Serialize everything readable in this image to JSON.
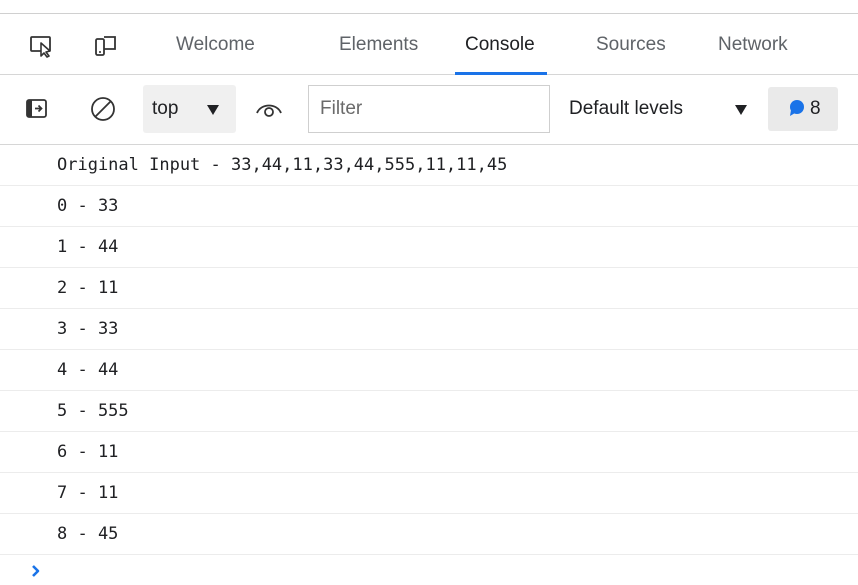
{
  "tabbar": {
    "icons": [
      "inspect-element-icon",
      "device-toolbar-icon"
    ],
    "tabs": [
      {
        "label": "Welcome",
        "active": false
      },
      {
        "label": "Elements",
        "active": false
      },
      {
        "label": "Console",
        "active": true
      },
      {
        "label": "Sources",
        "active": false
      },
      {
        "label": "Network",
        "active": false
      }
    ],
    "accent_color": "#1a73e8"
  },
  "toolbar": {
    "icons": [
      "sidebar-toggle-icon",
      "clear-console-icon",
      "live-expression-eye-icon",
      "message-bubble-icon"
    ],
    "context_label": "top",
    "filter_placeholder": "Filter",
    "levels_label": "Default levels",
    "message_count": "8",
    "badge_color": "#1a73e8"
  },
  "console": {
    "lines": [
      "Original Input - 33,44,11,33,44,555,11,11,45",
      "0 - 33",
      "1 - 44",
      "2 - 11",
      "3 - 33",
      "4 - 44",
      "5 - 555",
      "6 - 11",
      "7 - 11",
      "8 - 45"
    ],
    "prompt_color": "#1a73e8"
  }
}
